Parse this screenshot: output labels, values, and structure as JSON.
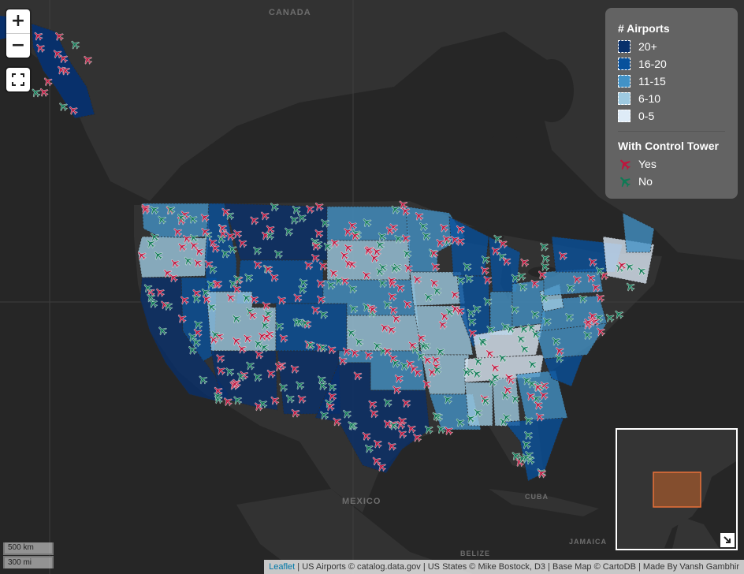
{
  "map": {
    "labels": [
      {
        "text": "CANADA"
      },
      {
        "text": "MEXICO"
      },
      {
        "text": "CUBA"
      },
      {
        "text": "JAMAICA"
      },
      {
        "text": "BELIZE"
      }
    ]
  },
  "controls": {
    "zoom_in": "+",
    "zoom_out": "−"
  },
  "legend": {
    "title": "# Airports",
    "bins": [
      {
        "label": "20+",
        "color": "#08306b"
      },
      {
        "label": "16-20",
        "color": "#08519c"
      },
      {
        "label": "11-15",
        "color": "#4292c6"
      },
      {
        "label": "6-10",
        "color": "#9ecae1"
      },
      {
        "label": "0-5",
        "color": "#deebf7"
      }
    ],
    "tower_title": "With Control Tower",
    "tower_items": [
      {
        "label": "Yes",
        "color": "#c0143c"
      },
      {
        "label": "No",
        "color": "#0f7a55"
      }
    ]
  },
  "scale": {
    "km": "500 km",
    "mi": "300 mi"
  },
  "attribution": {
    "leaflet": "Leaflet",
    "rest": " | US Airports © catalog.data.gov | US States © Mike Bostock, D3 | Base Map © CartoDB | Made By Vansh Gambhir"
  }
}
